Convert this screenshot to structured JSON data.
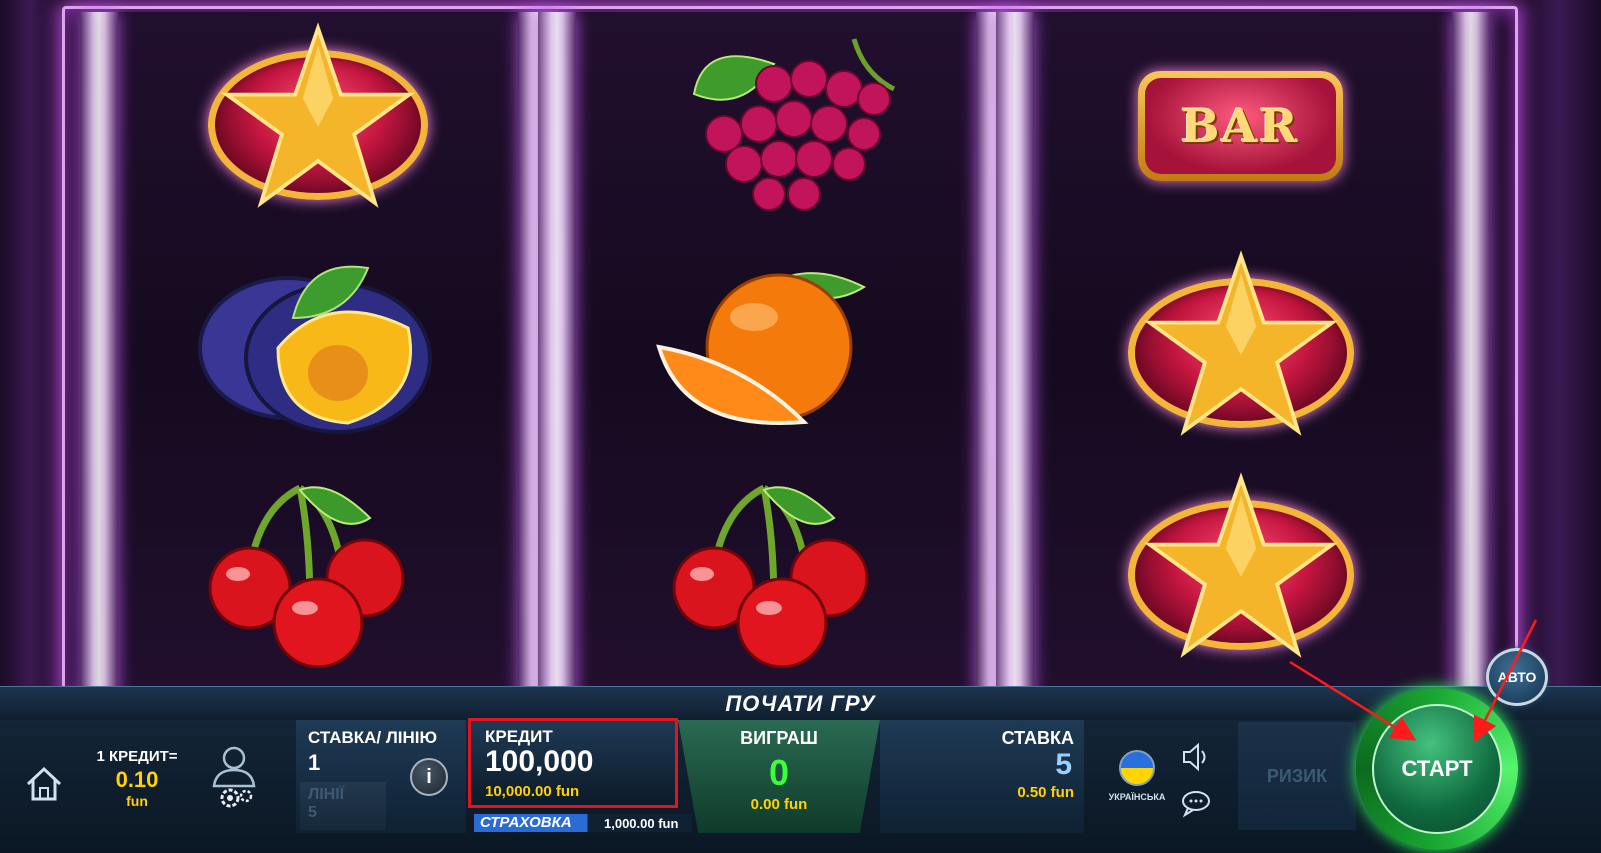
{
  "reels": [
    [
      "star",
      "plum",
      "cherry"
    ],
    [
      "grapes",
      "orange",
      "cherry"
    ],
    [
      "bar",
      "star",
      "star"
    ]
  ],
  "bar_label": "BAR",
  "title_strip": "ПОЧАТИ ГРУ",
  "credit_value_info": {
    "line1": "1 КРЕДИТ=",
    "value": "0.10",
    "unit": "fun"
  },
  "stake_per_line": {
    "label": "СТАВКА/ ЛІНІЮ",
    "value": "1",
    "lines_label": "ЛІНІЇ",
    "lines_value": "5"
  },
  "info_button": "i",
  "credit": {
    "label": "КРЕДИТ",
    "value": "100,000",
    "fun": "10,000.00 fun"
  },
  "win": {
    "label": "ВИГРАШ",
    "value": "0",
    "fun": "0.00 fun"
  },
  "total_stake": {
    "label": "СТАВКА",
    "value": "5",
    "fun": "0.50 fun"
  },
  "insurance": {
    "label": "СТРАХОВКА",
    "value": "1,000.00 fun"
  },
  "language": {
    "label": "УКРАЇНСЬКА"
  },
  "risk_button": "РИЗИК",
  "start_button": "СТАРТ",
  "auto_button": "АВТО",
  "colors": {
    "highlight_box": "#e4141f",
    "win_green": "#3cff3c",
    "gold": "#ffd200"
  }
}
